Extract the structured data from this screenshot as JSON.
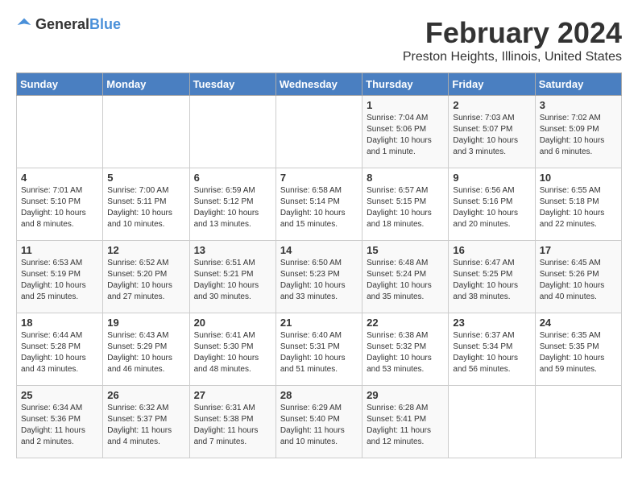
{
  "header": {
    "logo_general": "General",
    "logo_blue": "Blue",
    "title": "February 2024",
    "subtitle": "Preston Heights, Illinois, United States"
  },
  "calendar": {
    "days_of_week": [
      "Sunday",
      "Monday",
      "Tuesday",
      "Wednesday",
      "Thursday",
      "Friday",
      "Saturday"
    ],
    "weeks": [
      [
        {
          "day": "",
          "info": ""
        },
        {
          "day": "",
          "info": ""
        },
        {
          "day": "",
          "info": ""
        },
        {
          "day": "",
          "info": ""
        },
        {
          "day": "1",
          "info": "Sunrise: 7:04 AM\nSunset: 5:06 PM\nDaylight: 10 hours and 1 minute."
        },
        {
          "day": "2",
          "info": "Sunrise: 7:03 AM\nSunset: 5:07 PM\nDaylight: 10 hours and 3 minutes."
        },
        {
          "day": "3",
          "info": "Sunrise: 7:02 AM\nSunset: 5:09 PM\nDaylight: 10 hours and 6 minutes."
        }
      ],
      [
        {
          "day": "4",
          "info": "Sunrise: 7:01 AM\nSunset: 5:10 PM\nDaylight: 10 hours and 8 minutes."
        },
        {
          "day": "5",
          "info": "Sunrise: 7:00 AM\nSunset: 5:11 PM\nDaylight: 10 hours and 10 minutes."
        },
        {
          "day": "6",
          "info": "Sunrise: 6:59 AM\nSunset: 5:12 PM\nDaylight: 10 hours and 13 minutes."
        },
        {
          "day": "7",
          "info": "Sunrise: 6:58 AM\nSunset: 5:14 PM\nDaylight: 10 hours and 15 minutes."
        },
        {
          "day": "8",
          "info": "Sunrise: 6:57 AM\nSunset: 5:15 PM\nDaylight: 10 hours and 18 minutes."
        },
        {
          "day": "9",
          "info": "Sunrise: 6:56 AM\nSunset: 5:16 PM\nDaylight: 10 hours and 20 minutes."
        },
        {
          "day": "10",
          "info": "Sunrise: 6:55 AM\nSunset: 5:18 PM\nDaylight: 10 hours and 22 minutes."
        }
      ],
      [
        {
          "day": "11",
          "info": "Sunrise: 6:53 AM\nSunset: 5:19 PM\nDaylight: 10 hours and 25 minutes."
        },
        {
          "day": "12",
          "info": "Sunrise: 6:52 AM\nSunset: 5:20 PM\nDaylight: 10 hours and 27 minutes."
        },
        {
          "day": "13",
          "info": "Sunrise: 6:51 AM\nSunset: 5:21 PM\nDaylight: 10 hours and 30 minutes."
        },
        {
          "day": "14",
          "info": "Sunrise: 6:50 AM\nSunset: 5:23 PM\nDaylight: 10 hours and 33 minutes."
        },
        {
          "day": "15",
          "info": "Sunrise: 6:48 AM\nSunset: 5:24 PM\nDaylight: 10 hours and 35 minutes."
        },
        {
          "day": "16",
          "info": "Sunrise: 6:47 AM\nSunset: 5:25 PM\nDaylight: 10 hours and 38 minutes."
        },
        {
          "day": "17",
          "info": "Sunrise: 6:45 AM\nSunset: 5:26 PM\nDaylight: 10 hours and 40 minutes."
        }
      ],
      [
        {
          "day": "18",
          "info": "Sunrise: 6:44 AM\nSunset: 5:28 PM\nDaylight: 10 hours and 43 minutes."
        },
        {
          "day": "19",
          "info": "Sunrise: 6:43 AM\nSunset: 5:29 PM\nDaylight: 10 hours and 46 minutes."
        },
        {
          "day": "20",
          "info": "Sunrise: 6:41 AM\nSunset: 5:30 PM\nDaylight: 10 hours and 48 minutes."
        },
        {
          "day": "21",
          "info": "Sunrise: 6:40 AM\nSunset: 5:31 PM\nDaylight: 10 hours and 51 minutes."
        },
        {
          "day": "22",
          "info": "Sunrise: 6:38 AM\nSunset: 5:32 PM\nDaylight: 10 hours and 53 minutes."
        },
        {
          "day": "23",
          "info": "Sunrise: 6:37 AM\nSunset: 5:34 PM\nDaylight: 10 hours and 56 minutes."
        },
        {
          "day": "24",
          "info": "Sunrise: 6:35 AM\nSunset: 5:35 PM\nDaylight: 10 hours and 59 minutes."
        }
      ],
      [
        {
          "day": "25",
          "info": "Sunrise: 6:34 AM\nSunset: 5:36 PM\nDaylight: 11 hours and 2 minutes."
        },
        {
          "day": "26",
          "info": "Sunrise: 6:32 AM\nSunset: 5:37 PM\nDaylight: 11 hours and 4 minutes."
        },
        {
          "day": "27",
          "info": "Sunrise: 6:31 AM\nSunset: 5:38 PM\nDaylight: 11 hours and 7 minutes."
        },
        {
          "day": "28",
          "info": "Sunrise: 6:29 AM\nSunset: 5:40 PM\nDaylight: 11 hours and 10 minutes."
        },
        {
          "day": "29",
          "info": "Sunrise: 6:28 AM\nSunset: 5:41 PM\nDaylight: 11 hours and 12 minutes."
        },
        {
          "day": "",
          "info": ""
        },
        {
          "day": "",
          "info": ""
        }
      ]
    ]
  }
}
